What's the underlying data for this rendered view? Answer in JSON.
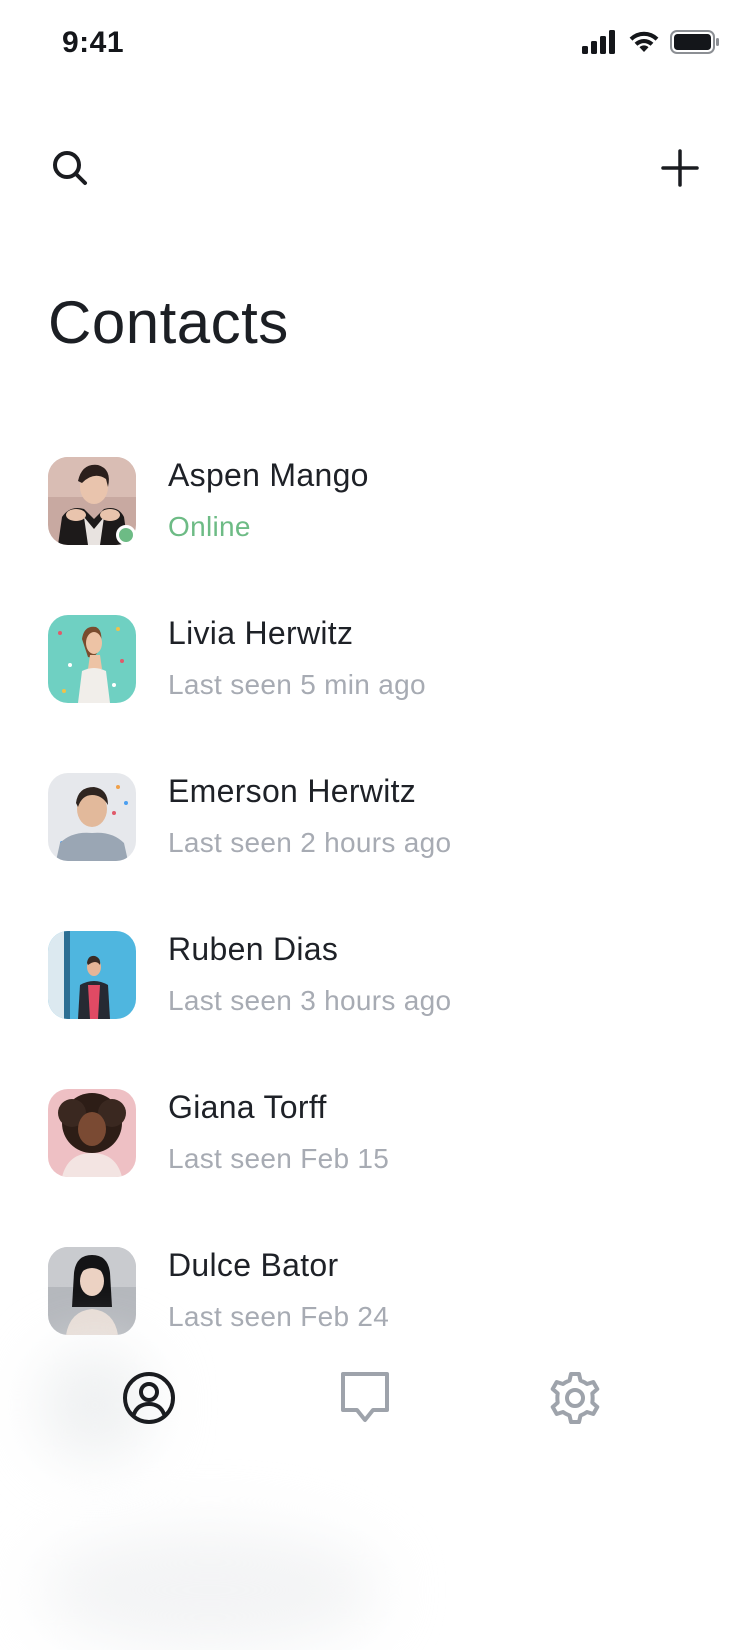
{
  "status_bar": {
    "time": "9:41",
    "icons": [
      "cellular-signal-icon",
      "wifi-icon",
      "battery-icon"
    ]
  },
  "header": {
    "search_icon": "search-icon",
    "add_icon": "plus-icon",
    "title": "Contacts"
  },
  "contacts": [
    {
      "name": "Aspen Mango",
      "status": "Online",
      "online": true
    },
    {
      "name": "Livia Herwitz",
      "status": "Last seen 5 min ago",
      "online": false
    },
    {
      "name": "Emerson Herwitz",
      "status": "Last seen 2 hours ago",
      "online": false
    },
    {
      "name": "Ruben Dias",
      "status": "Last seen 3 hours ago",
      "online": false
    },
    {
      "name": "Giana Torff",
      "status": "Last seen Feb 15",
      "online": false
    },
    {
      "name": "Dulce Bator",
      "status": "Last seen Feb 24",
      "online": false
    }
  ],
  "tabbar": {
    "tabs": [
      {
        "icon": "contacts-icon",
        "active": true
      },
      {
        "icon": "chat-icon",
        "active": false
      },
      {
        "icon": "settings-icon",
        "active": false
      }
    ]
  },
  "colors": {
    "online": "#6dbb85",
    "muted_text": "#a7abb3",
    "primary_text": "#1e2127",
    "inactive_icon": "#9ea3ab"
  }
}
